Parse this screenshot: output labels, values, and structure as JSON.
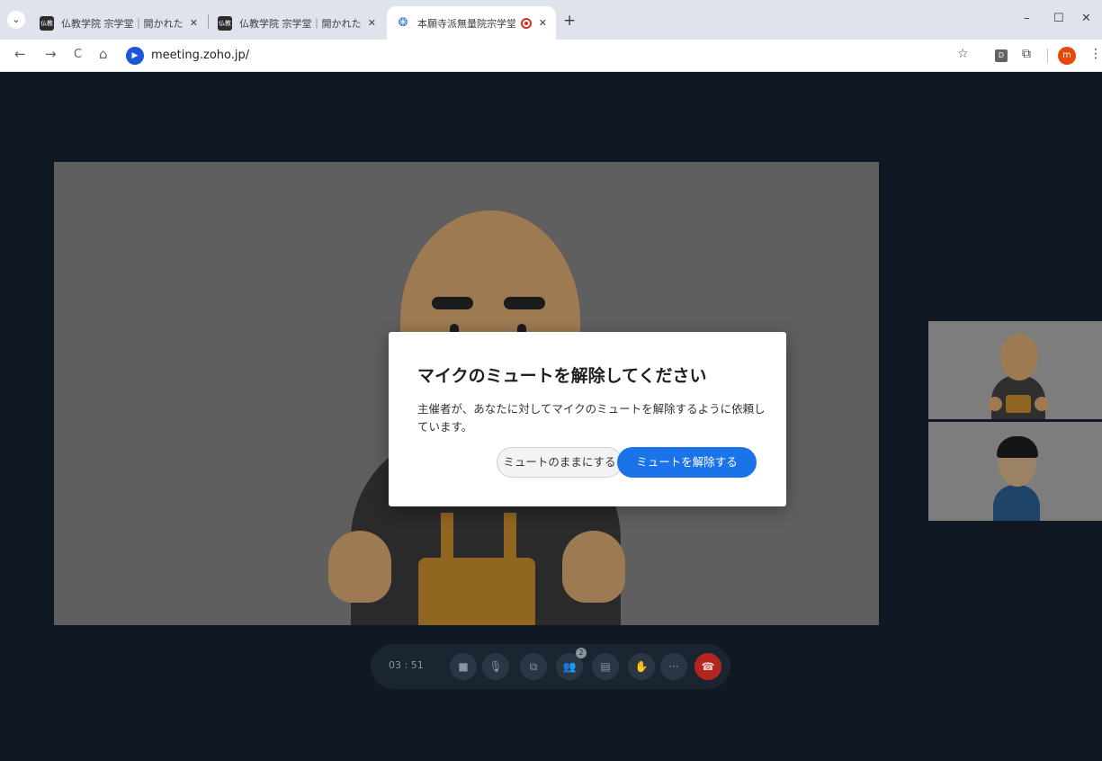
{
  "browser": {
    "tabs": [
      {
        "favicon_text": "仏教",
        "title": "仏教学院 宗学堂｜開かれた仏教",
        "close": "✕"
      },
      {
        "favicon_text": "仏教",
        "title": "仏教学院 宗学堂｜開かれた仏教",
        "close": "✕"
      },
      {
        "favicon_text": "❂",
        "title": "本願寺派無量院宗学堂 基",
        "close": "✕"
      }
    ],
    "tab_menu": "⌄",
    "new_tab": "+",
    "window_controls": {
      "minimize": "–",
      "maximize": "☐",
      "close": "✕"
    },
    "url": "meeting.zoho.jp/",
    "site_icon": "▶",
    "extension_label": "D",
    "profile_initial": "m",
    "icons": {
      "back": "←",
      "forward": "→",
      "reload": "C",
      "home": "⌂",
      "bookmark": "☆",
      "extensions": "⧉",
      "menu": "⋮"
    }
  },
  "dialog": {
    "title": "マイクのミュートを解除してください",
    "body": "主催者が、あなたに対してマイクのミュートを解除するように依頼しています。",
    "keep_muted_label": "ミュートのままにする",
    "unmute_label": "ミュートを解除する"
  },
  "controls": {
    "timer": "03 : 51",
    "participants_badge": "2",
    "icons": {
      "video": "■",
      "mic": "🎙",
      "share": "⧉",
      "participants": "👥",
      "chat": "▤",
      "reactions": "✋",
      "more": "···",
      "end": "☎"
    }
  },
  "colors": {
    "stage_bg": "#101923",
    "primary_button": "#1a73e8",
    "end_call": "#b3261e"
  }
}
